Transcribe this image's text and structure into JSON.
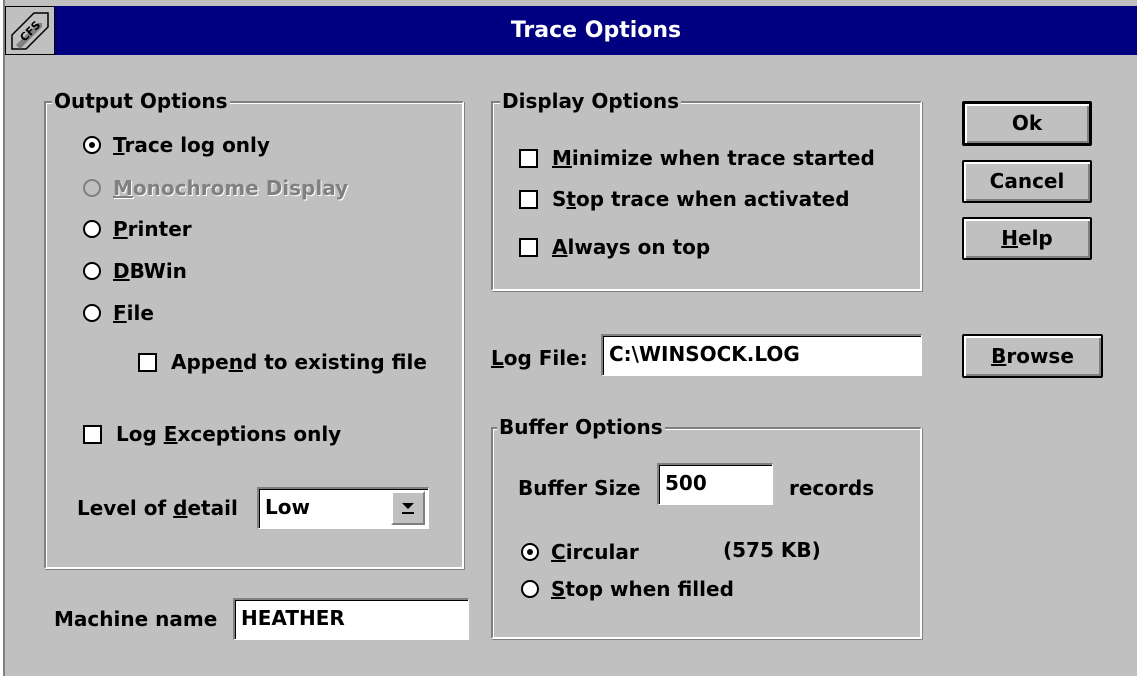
{
  "window": {
    "title": "Trace Options",
    "system_menu_icon": "cfs-logo-icon"
  },
  "output_options": {
    "legend": "Output Options",
    "radios": [
      {
        "pre": "",
        "u": "T",
        "post": "race log only",
        "checked": true,
        "enabled": true
      },
      {
        "pre": "",
        "u": "M",
        "post": "onochrome Display",
        "checked": false,
        "enabled": false
      },
      {
        "pre": "",
        "u": "P",
        "post": "rinter",
        "checked": false,
        "enabled": true
      },
      {
        "pre": "",
        "u": "D",
        "post": "BWin",
        "checked": false,
        "enabled": true
      },
      {
        "pre": "",
        "u": "F",
        "post": "ile",
        "checked": false,
        "enabled": true
      }
    ],
    "append": {
      "pre": "Appe",
      "u": "n",
      "post": "d to existing file",
      "checked": false
    },
    "exceptions": {
      "pre": "Log ",
      "u": "E",
      "post": "xceptions only",
      "checked": false
    },
    "detail": {
      "label_pre": "Level of ",
      "label_u": "d",
      "label_post": "etail",
      "value": "Low"
    }
  },
  "machine": {
    "label": "Machine name",
    "value": "HEATHER"
  },
  "display_options": {
    "legend": "Display Options",
    "checks": [
      {
        "pre": "",
        "u": "M",
        "post": "inimize when trace started",
        "checked": false
      },
      {
        "pre": "S",
        "u": "t",
        "post": "op trace when activated",
        "checked": false
      },
      {
        "pre": "",
        "u": "A",
        "post": "lways on top",
        "checked": false
      }
    ]
  },
  "log_file": {
    "label_u": "L",
    "label_post": "og File:",
    "value": "C:\\WINSOCK.LOG"
  },
  "buffer_options": {
    "legend": "Buffer Options",
    "size_label": "Buffer Size",
    "size_value": "500",
    "size_unit": "records",
    "size_kb": "(575 KB)",
    "radios": [
      {
        "pre": "",
        "u": "C",
        "post": "ircular",
        "checked": true
      },
      {
        "pre": "",
        "u": "S",
        "post": "top when filled",
        "checked": false
      }
    ]
  },
  "buttons": {
    "ok": {
      "pre": "Ok",
      "u": "",
      "post": ""
    },
    "cancel": {
      "pre": "Cancel",
      "u": "",
      "post": ""
    },
    "help": {
      "pre": "",
      "u": "H",
      "post": "elp"
    },
    "browse": {
      "pre": "",
      "u": "B",
      "post": "rowse"
    }
  }
}
